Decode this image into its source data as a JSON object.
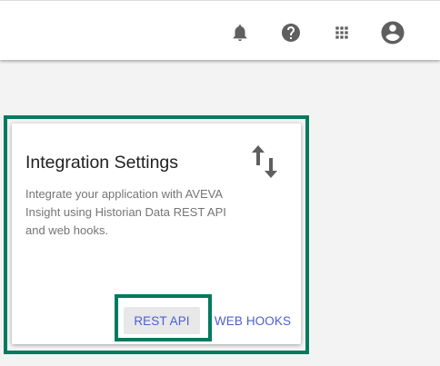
{
  "header": {
    "icons": [
      "bell-icon",
      "help-icon",
      "apps-grid-icon",
      "account-icon"
    ]
  },
  "card": {
    "title": "Integration Settings",
    "description": "Integrate your application with AVEVA Insight using Historian Data REST API and web hooks.",
    "icon": "swap-vertical-icon",
    "rest_api_label": "REST API",
    "web_hooks_label": "WEB HOOKS"
  },
  "colors": {
    "highlight": "#007a5e",
    "button_text": "#4b5fd0",
    "icon": "#5f5f5f"
  }
}
